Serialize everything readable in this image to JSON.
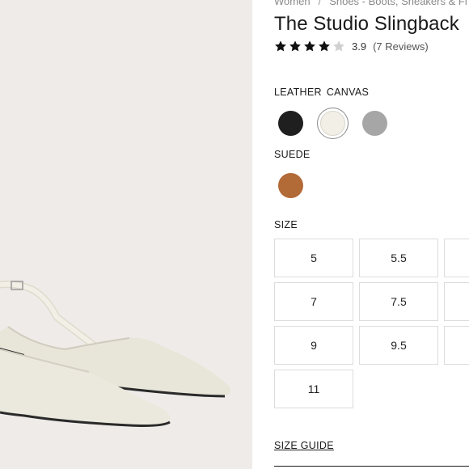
{
  "breadcrumb": {
    "items": [
      "Women",
      "Shoes - Boots, Sneakers & Fl"
    ],
    "separator": "/"
  },
  "product": {
    "title": "The Studio Slingback",
    "rating": {
      "value": "3.9",
      "filled_stars": 4,
      "total_stars": 5,
      "reviews": "(7 Reviews)"
    }
  },
  "materials": {
    "leather_label": "LEATHER",
    "canvas_label": "CANVAS",
    "leather_swatches": [
      {
        "name": "black",
        "color": "#1f1f1f",
        "selected": false
      },
      {
        "name": "white",
        "color": "#f1efe6",
        "selected": true
      },
      {
        "name": "grey",
        "color": "#a6a6a6",
        "selected": false
      }
    ],
    "suede_label": "SUEDE",
    "suede_swatches": [
      {
        "name": "cognac",
        "color": "#b26a37",
        "selected": false
      }
    ]
  },
  "sizes": {
    "label": "SIZE",
    "options": [
      "5",
      "5.5",
      "7",
      "7.5",
      "9",
      "9.5",
      "11"
    ]
  },
  "size_guide_label": "SIZE GUIDE",
  "colors": {
    "image_bg": "#efebe8",
    "shoe": "#e9e6da",
    "border": "#dcdcdc"
  }
}
